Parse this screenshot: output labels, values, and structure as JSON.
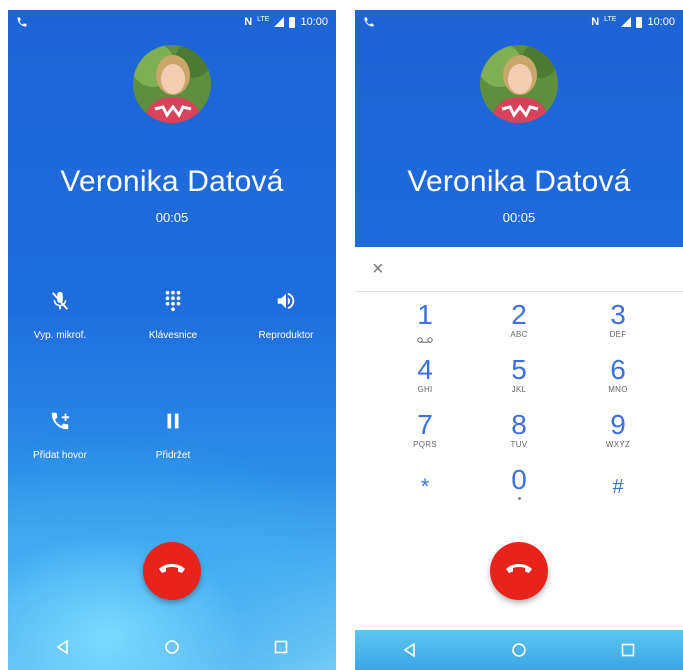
{
  "status_bar": {
    "time": "10:00",
    "network": "LTE",
    "nfc": "N"
  },
  "left_screen": {
    "contact_name": "Veronika Datová",
    "call_timer": "00:05",
    "controls": [
      {
        "label": "Vyp. mikrof.",
        "icon": "mic-off-icon"
      },
      {
        "label": "Klávesnice",
        "icon": "dialpad-icon"
      },
      {
        "label": "Reproduktor",
        "icon": "speaker-icon"
      },
      {
        "label": "Přidat hovor",
        "icon": "add-call-icon"
      },
      {
        "label": "Přidržet",
        "icon": "pause-icon"
      }
    ]
  },
  "right_screen": {
    "contact_name": "Veronika Datová",
    "call_timer": "00:05",
    "close_symbol": "×",
    "keys": [
      {
        "digit": "1",
        "letters": ""
      },
      {
        "digit": "2",
        "letters": "ABC"
      },
      {
        "digit": "3",
        "letters": "DEF"
      },
      {
        "digit": "4",
        "letters": "GHI"
      },
      {
        "digit": "5",
        "letters": "JKL"
      },
      {
        "digit": "6",
        "letters": "MNO"
      },
      {
        "digit": "7",
        "letters": "PQRS"
      },
      {
        "digit": "8",
        "letters": "TUV"
      },
      {
        "digit": "9",
        "letters": "WXYZ"
      },
      {
        "digit": "*",
        "letters": ""
      },
      {
        "digit": "0",
        "letters": ""
      },
      {
        "digit": "#",
        "letters": ""
      }
    ]
  },
  "colors": {
    "accent": "#1f63d5",
    "end_call": "#e8231c",
    "dial_digit": "#3d6fe0"
  }
}
